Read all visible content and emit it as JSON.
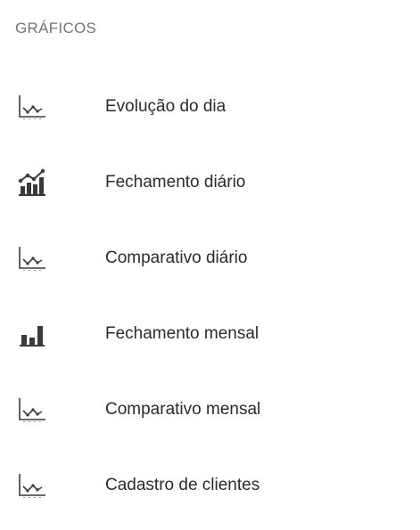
{
  "section": {
    "title": "GRÁFICOS"
  },
  "colors": {
    "icon": "#3a3a3a",
    "label": "#2b2b2b",
    "section_title": "#757575",
    "background": "#ffffff"
  },
  "items": [
    {
      "label": "Evolução do dia",
      "icon": "line-chart-icon"
    },
    {
      "label": "Fechamento diário",
      "icon": "bar-chart-trend-icon"
    },
    {
      "label": "Comparativo diário",
      "icon": "line-chart-icon"
    },
    {
      "label": "Fechamento mensal",
      "icon": "bar-chart-icon"
    },
    {
      "label": "Comparativo mensal",
      "icon": "line-chart-icon"
    },
    {
      "label": "Cadastro de clientes",
      "icon": "line-chart-icon"
    }
  ]
}
